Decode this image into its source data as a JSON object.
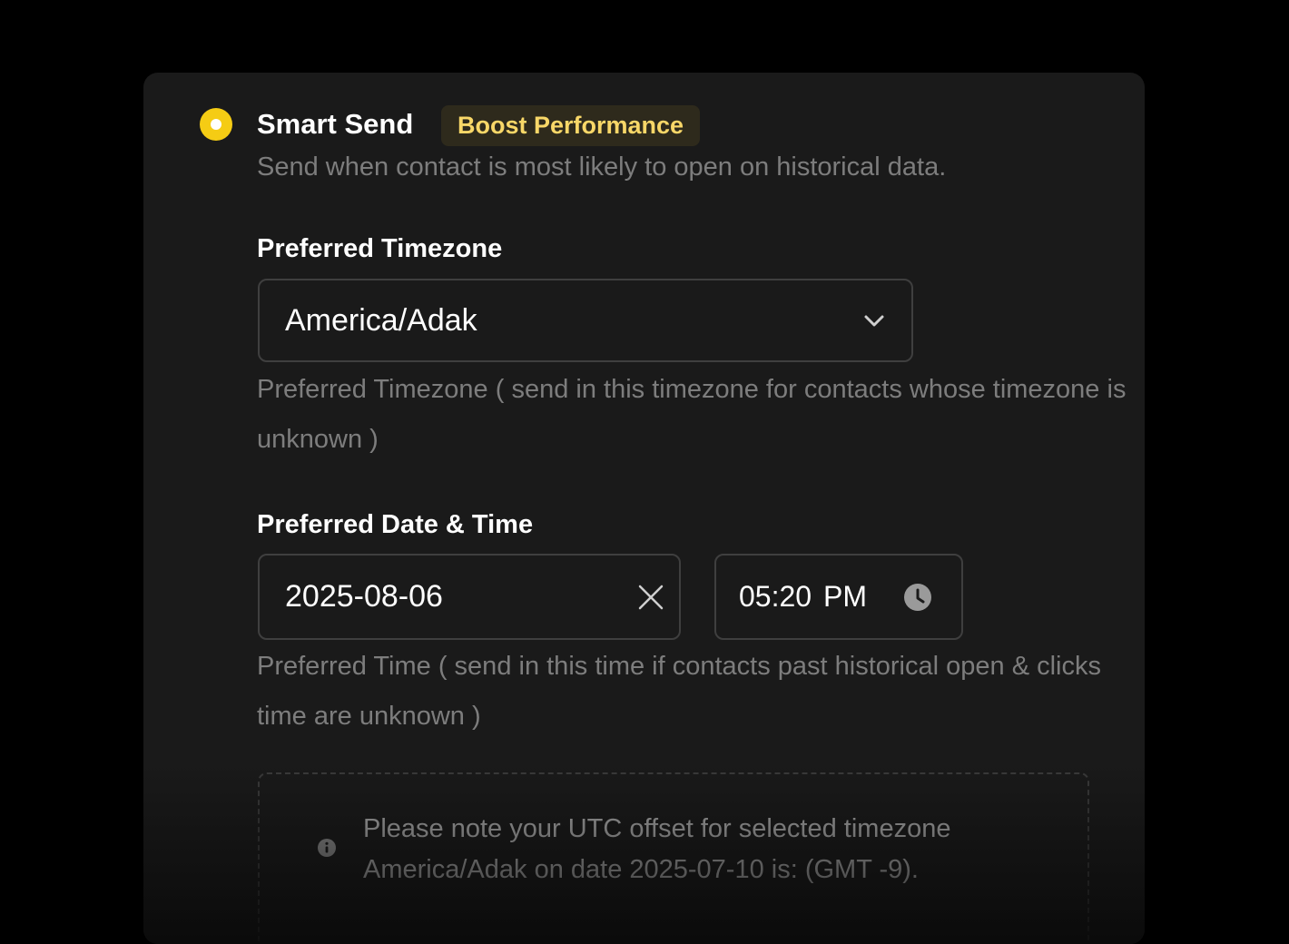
{
  "smart_send": {
    "title": "Smart Send",
    "badge": "Boost Performance",
    "description": "Send when contact is most likely to open on historical data.",
    "selected": true
  },
  "timezone": {
    "label": "Preferred Timezone",
    "value": "America/Adak",
    "helper": "Preferred Timezone ( send in this timezone for contacts whose timezone is unknown )"
  },
  "datetime": {
    "label": "Preferred Date & Time",
    "date": "2025-08-06",
    "time": "05:20 PM",
    "helper": "Preferred Time ( send in this time if contacts past historical open & clicks time are unknown )"
  },
  "note": {
    "line1": "Please note your UTC offset for selected timezone",
    "line2": "America/Adak on date 2025-07-10 is: (GMT -9)."
  },
  "icons": {
    "dropdown": "chevron-down-icon",
    "clear": "close-icon",
    "time": "clock-icon",
    "info": "info-icon"
  },
  "colors": {
    "accent": "#f5cc14",
    "badge_text": "#f8d768",
    "badge_bg": "#2e2a1c",
    "card_bg": "#1a1a1a"
  }
}
